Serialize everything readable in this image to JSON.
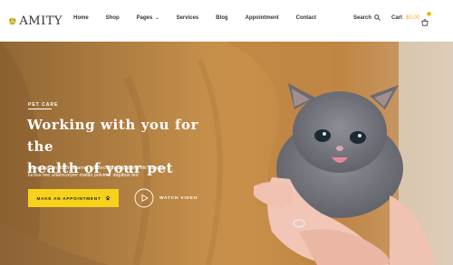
{
  "brand": {
    "name": "MITY",
    "logo_letter": "A"
  },
  "nav": {
    "items": [
      {
        "label": "Home"
      },
      {
        "label": "Shop"
      },
      {
        "label": "Pages"
      },
      {
        "label": "Services"
      },
      {
        "label": "Blog"
      },
      {
        "label": "Appointment"
      },
      {
        "label": "Contact"
      }
    ]
  },
  "header_actions": {
    "search_label": "Search",
    "cart_label": "Cart",
    "cart_amount": "$0.00",
    "cart_count": "0"
  },
  "hero": {
    "eyebrow": "PET CARE",
    "headline_line1": "Working with you for the",
    "headline_line2": "health of your pet",
    "lead_line1": "Lorem ipsum dolor sit amet consectetur adipiscing elit ull tellus",
    "lead_line2": "luctus nec ullamcorper mattis pulvinar dapibus leo",
    "cta_label": "Make an appointment",
    "video_label": "Watch video"
  },
  "colors": {
    "accent": "#f7d21a",
    "cart_amount": "#f2a91c",
    "sweater": "#d99a47",
    "kitten": "#7a7b82"
  },
  "icons": {
    "search": "search-icon",
    "cart": "cart-icon",
    "cta": "paw-icon",
    "video": "play-icon"
  }
}
